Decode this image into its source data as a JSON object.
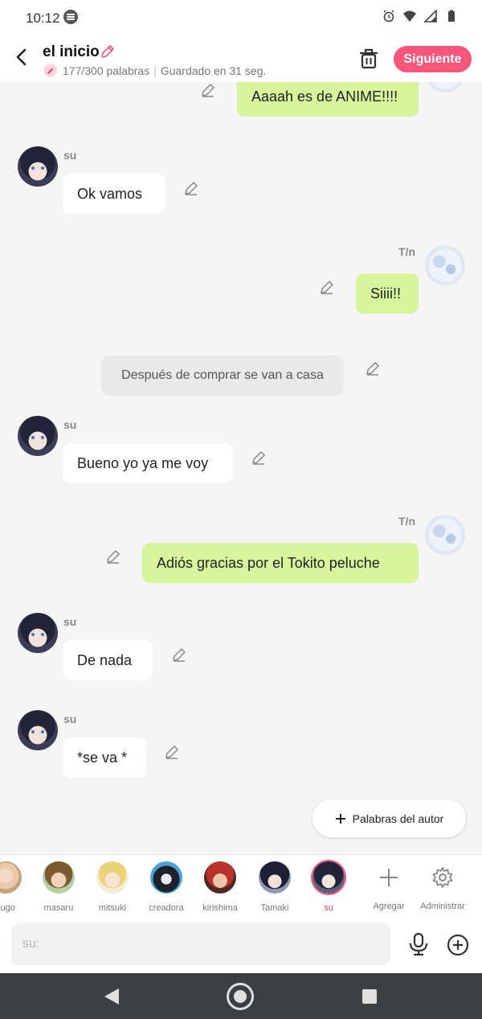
{
  "status_bar": {
    "time": "10:12",
    "icons": [
      "spotify-icon",
      "alarm-icon",
      "wifi-icon",
      "signal-icon",
      "battery-icon"
    ]
  },
  "header": {
    "title": "el inicio",
    "word_count": "177/300 palabras",
    "separator": "|",
    "saved": "Guardado en 31 seg.",
    "next_label": "Siguiente",
    "accent": "#f5567a"
  },
  "chat": {
    "messages": [
      {
        "speaker": "T/n",
        "text": "Aaaah es de ANIME!!!!"
      },
      {
        "speaker": "su",
        "text": "Ok vamos"
      },
      {
        "speaker": "T/n",
        "text": "Siiii!!"
      },
      {
        "speaker": "narration",
        "text": "Después de comprar se van a casa"
      },
      {
        "speaker": "su",
        "text": "Bueno yo ya me voy"
      },
      {
        "speaker": "T/n",
        "text": "Adiós gracias por el Tokito peluche"
      },
      {
        "speaker": "su",
        "text": "De nada"
      },
      {
        "speaker": "su",
        "text": "*se va *"
      }
    ],
    "names": {
      "su": "su",
      "tn": "T/n"
    },
    "author_words_label": "Palabras del autor",
    "bubble_color_right": "#d6f59c"
  },
  "characters": [
    {
      "label": "kugo"
    },
    {
      "label": "masaru"
    },
    {
      "label": "mitsuki"
    },
    {
      "label": "creadora"
    },
    {
      "label": "kirishima"
    },
    {
      "label": "Tamaki"
    },
    {
      "label": "su",
      "active": true
    }
  ],
  "tools": {
    "add_label": "Agregar",
    "admin_label": "Administrar"
  },
  "input": {
    "placeholder": "su:",
    "value": ""
  }
}
